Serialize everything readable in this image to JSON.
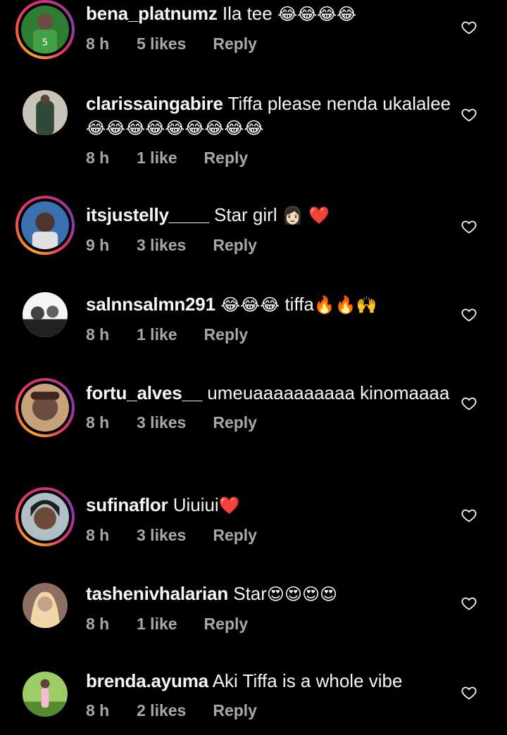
{
  "comments": [
    {
      "username": "bena_platnumz",
      "text": "Ila tee",
      "emoji": "😂😂😂😂",
      "time": "8 h",
      "likes": "5 likes",
      "reply": "Reply",
      "story_ring": true,
      "avatar_color": "#2e7d32"
    },
    {
      "username": "clarissaingabire",
      "text": "Tiffa please nenda ukalalee",
      "emoji": "😂😂😂😂😂😂😂😂😂",
      "time": "8 h",
      "likes": "1 like",
      "reply": "Reply",
      "story_ring": false,
      "avatar_color": "#4e5d52"
    },
    {
      "username": "itsjustelly____",
      "text": "Star girl",
      "emoji": "👩🏻 ❤️",
      "time": "9 h",
      "likes": "3 likes",
      "reply": "Reply",
      "story_ring": true,
      "avatar_color": "#3a6fb0"
    },
    {
      "username": "salnnsalmn291",
      "text": "tiffa",
      "emoji_before": "😂😂😂",
      "emoji": "🔥🔥🙌",
      "time": "8 h",
      "likes": "1 like",
      "reply": "Reply",
      "story_ring": false,
      "avatar_color": "#9e9e9e"
    },
    {
      "username": "fortu_alves__",
      "text": "umeuaaaaaaaaaa kinomaaaa",
      "emoji": "",
      "time": "8 h",
      "likes": "3 likes",
      "reply": "Reply",
      "story_ring": true,
      "avatar_color": "#8d5a3c"
    },
    {
      "username": "sufinaflor",
      "text": "Uiuiui",
      "emoji": "❤️",
      "time": "8 h",
      "likes": "3 likes",
      "reply": "Reply",
      "story_ring": true,
      "avatar_color": "#6b4a3a"
    },
    {
      "username": "tashenivhalarian",
      "text": "Star",
      "emoji": "😍😍😍😍",
      "time": "8 h",
      "likes": "1 like",
      "reply": "Reply",
      "story_ring": false,
      "avatar_color": "#c9a08a"
    },
    {
      "username": "brenda.ayuma",
      "text": "Aki Tiffa is a whole vibe",
      "emoji": "",
      "time": "8 h",
      "likes": "2 likes",
      "reply": "Reply",
      "story_ring": false,
      "avatar_color": "#7a8a5a"
    }
  ],
  "icons": {
    "like": "heart-outline-icon"
  },
  "colors": {
    "background": "#000000",
    "text": "#f5f5f5",
    "meta": "#a8a8a8"
  }
}
